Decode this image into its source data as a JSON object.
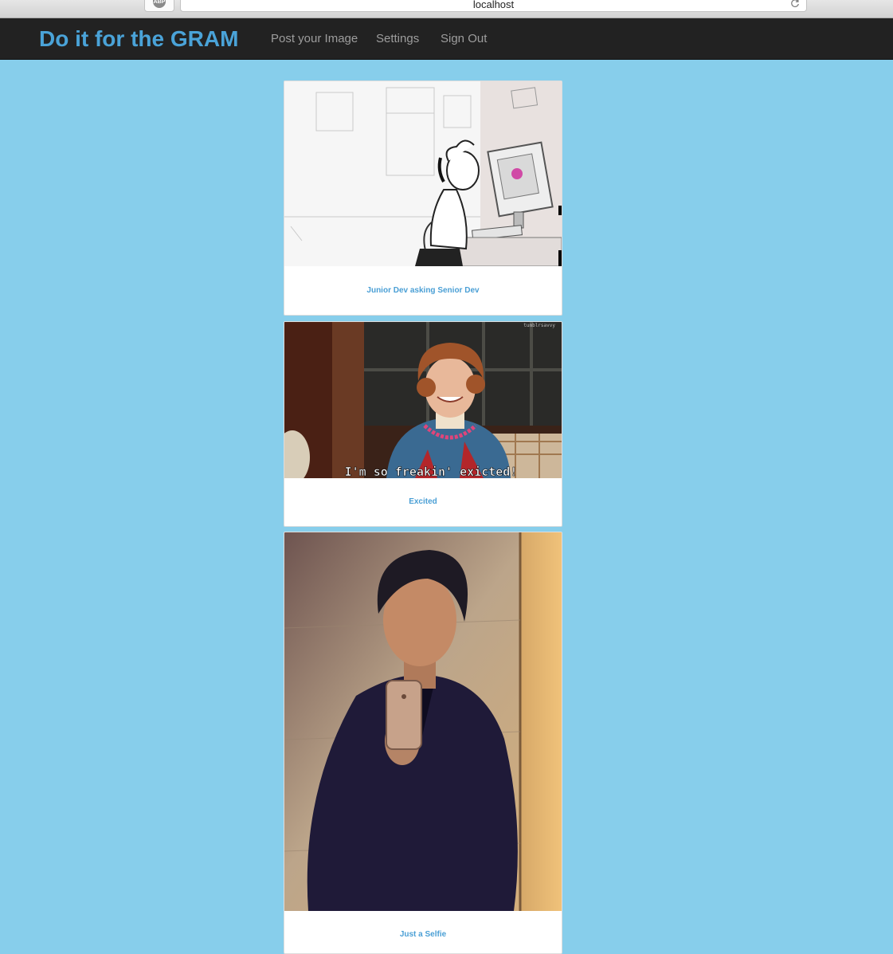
{
  "browser": {
    "url": "localhost",
    "extension_badge": "ABP"
  },
  "navbar": {
    "brand": "Do it for the GRAM",
    "links": [
      {
        "label": "Post your Image"
      },
      {
        "label": "Settings"
      },
      {
        "label": "Sign Out"
      }
    ]
  },
  "feed": {
    "posts": [
      {
        "caption": "Junior Dev asking Senior Dev",
        "image_icon": "cartoon-office-sketch"
      },
      {
        "caption": "Excited",
        "image_icon": "tv-show-still",
        "image_text": "I'm so freakin' exicted!",
        "watermark": "tumblrsavvy"
      },
      {
        "caption": "Just a Selfie",
        "image_icon": "mirror-selfie-photo"
      }
    ]
  },
  "colors": {
    "page_background": "#87ceeb",
    "navbar_background": "#222222",
    "brand": "#4aa3d8",
    "caption": "#4a9fd5",
    "nav_link": "#9d9d9d"
  }
}
